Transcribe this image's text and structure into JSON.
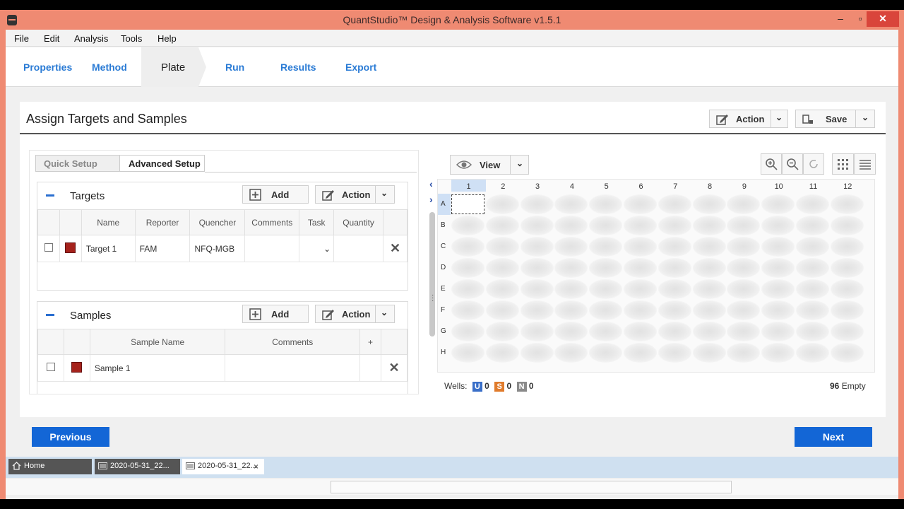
{
  "window": {
    "title": "QuantStudio™ Design & Analysis Software v1.5.1"
  },
  "menu": [
    "File",
    "Edit",
    "Analysis",
    "Tools",
    "Help"
  ],
  "tabs": {
    "properties": "Properties",
    "method": "Method",
    "plate": "Plate",
    "run": "Run",
    "results": "Results",
    "export": "Export",
    "active": "Plate"
  },
  "page": {
    "title": "Assign Targets and Samples",
    "action_label": "Action",
    "save_label": "Save"
  },
  "subtabs": {
    "quick": "Quick Setup",
    "advanced": "Advanced Setup",
    "active": "Advanced Setup"
  },
  "targets": {
    "title": "Targets",
    "add_label": "Add",
    "action_label": "Action",
    "columns": {
      "name": "Name",
      "reporter": "Reporter",
      "quencher": "Quencher",
      "comments": "Comments",
      "task": "Task",
      "quantity": "Quantity"
    },
    "row": {
      "name": "Target 1",
      "reporter": "FAM",
      "quencher": "NFQ-MGB",
      "comments": "",
      "task": "",
      "quantity": "",
      "color": "#a5221c"
    }
  },
  "samples": {
    "title": "Samples",
    "add_label": "Add",
    "action_label": "Action",
    "columns": {
      "sample_name": "Sample Name",
      "comments": "Comments",
      "plus": "+"
    },
    "row": {
      "name": "Sample 1",
      "comments": "",
      "color": "#a5221c"
    }
  },
  "plate": {
    "view_label": "View",
    "columns": [
      "1",
      "2",
      "3",
      "4",
      "5",
      "6",
      "7",
      "8",
      "9",
      "10",
      "11",
      "12"
    ],
    "rows": [
      "A",
      "B",
      "C",
      "D",
      "E",
      "F",
      "G",
      "H"
    ],
    "selected_well": "A1"
  },
  "wells_footer": {
    "label": "Wells:",
    "u_badge": "U",
    "u_count": "0",
    "s_badge": "S",
    "s_count": "0",
    "n_badge": "N",
    "n_count": "0",
    "empty_count": "96",
    "empty_label": "Empty"
  },
  "nav": {
    "previous": "Previous",
    "next": "Next"
  },
  "taskbar": {
    "home": "Home",
    "tab1": "2020-05-31_22...",
    "tab2": "2020-05-31_22..."
  },
  "colors": {
    "accent": "#1366d6",
    "tab_text": "#2a7bd5",
    "frame": "#ef8a72"
  }
}
